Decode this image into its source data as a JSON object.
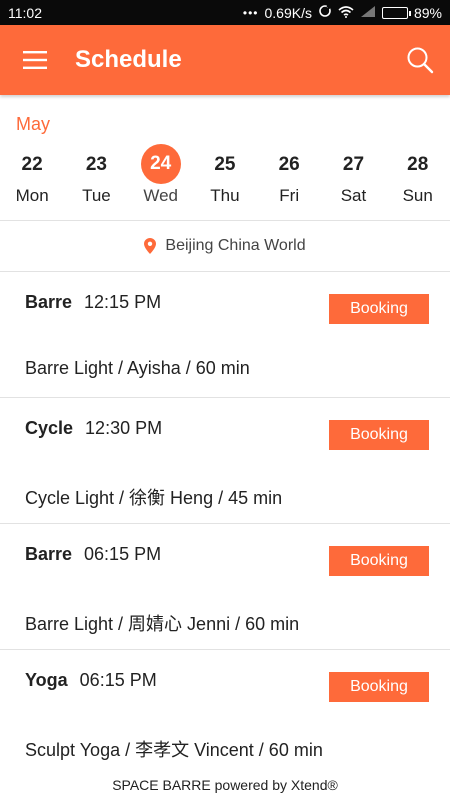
{
  "status_bar": {
    "time": "11:02",
    "network_speed": "0.69K/s",
    "battery_percent": "89%",
    "battery_level": 0.89
  },
  "app_bar": {
    "title": "Schedule",
    "menu_icon": "hamburger-menu-icon",
    "search_icon": "search-icon",
    "color": "#fe6a3a"
  },
  "calendar": {
    "month": "May",
    "days": [
      {
        "num": "22",
        "name": "Mon",
        "selected": false
      },
      {
        "num": "23",
        "name": "Tue",
        "selected": false
      },
      {
        "num": "24",
        "name": "Wed",
        "selected": true
      },
      {
        "num": "25",
        "name": "Thu",
        "selected": false
      },
      {
        "num": "26",
        "name": "Fri",
        "selected": false
      },
      {
        "num": "27",
        "name": "Sat",
        "selected": false
      },
      {
        "num": "28",
        "name": "Sun",
        "selected": false
      }
    ]
  },
  "location": {
    "name": "Beijing China World",
    "icon": "location-pin-icon"
  },
  "classes": [
    {
      "type": "Barre",
      "time": "12:15 PM",
      "button": "Booking",
      "desc": "Barre Light / Ayisha / 60 min"
    },
    {
      "type": "Cycle",
      "time": "12:30 PM",
      "button": "Booking",
      "desc": "Cycle Light / 徐衡 Heng / 45 min"
    },
    {
      "type": "Barre",
      "time": "06:15 PM",
      "button": "Booking",
      "desc": "Barre Light / 周婧心 Jenni / 60 min"
    },
    {
      "type": "Yoga",
      "time": "06:15 PM",
      "button": "Booking",
      "desc": "Sculpt Yoga / 李孝文 Vincent / 60 min"
    }
  ],
  "footer": {
    "text": "SPACE BARRE powered by Xtend®"
  }
}
